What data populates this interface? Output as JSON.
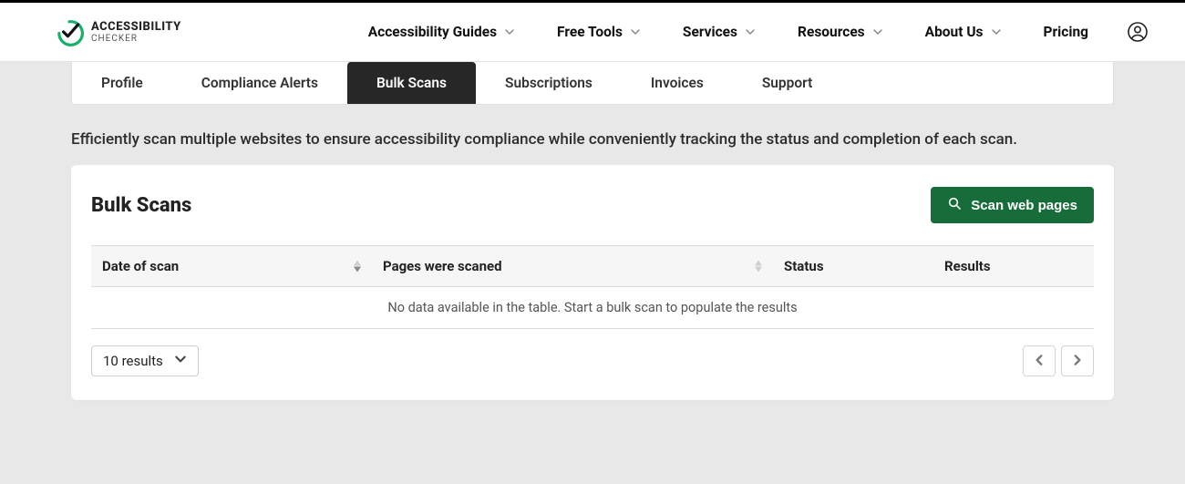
{
  "brand": {
    "line1": "ACCESSIBILITY",
    "line2": "CHECKER"
  },
  "nav": {
    "items": [
      {
        "label": "Accessibility Guides",
        "dropdown": true
      },
      {
        "label": "Free Tools",
        "dropdown": true
      },
      {
        "label": "Services",
        "dropdown": true
      },
      {
        "label": "Resources",
        "dropdown": true
      },
      {
        "label": "About Us",
        "dropdown": true
      },
      {
        "label": "Pricing",
        "dropdown": false
      }
    ]
  },
  "tabs": {
    "items": [
      {
        "label": "Profile",
        "active": false
      },
      {
        "label": "Compliance Alerts",
        "active": false
      },
      {
        "label": "Bulk Scans",
        "active": true
      },
      {
        "label": "Subscriptions",
        "active": false
      },
      {
        "label": "Invoices",
        "active": false
      },
      {
        "label": "Support",
        "active": false
      }
    ]
  },
  "intro": "Efficiently scan multiple websites to ensure accessibility compliance while conveniently tracking the status and completion of each scan.",
  "card": {
    "title": "Bulk Scans",
    "scan_button": "Scan web pages"
  },
  "table": {
    "columns": {
      "date": "Date of scan",
      "pages": "Pages were scaned",
      "status": "Status",
      "results": "Results"
    },
    "empty_message": "No data available in the table. Start a bulk scan to populate the results",
    "rows": []
  },
  "pagination": {
    "page_size_label": "10 results"
  }
}
